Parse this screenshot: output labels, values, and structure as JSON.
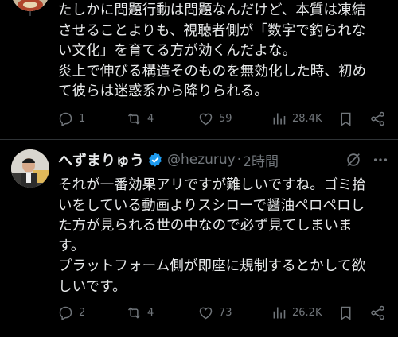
{
  "colors": {
    "background": "#000000",
    "text": "#e7e9ea",
    "muted": "#71767b",
    "verified": "#1d9bf0",
    "divider": "#2f3336"
  },
  "tweet1": {
    "text": "たしかに問題行動は問題なんだけど、本質は凍結\nさせることよりも、視聴者側が「数字で釣られな\nい文化」を育てる方が効くんだよな。\n炎上で伸びる構造そのものを無効化した時、初め\nて彼らは迷惑系から降りられる。",
    "replies": "1",
    "reposts": "4",
    "likes": "59",
    "views": "28.4K"
  },
  "tweet2": {
    "name": "へずまりゅう",
    "handle": "@hezuruy",
    "separator": "·",
    "time": "2時間",
    "text": "それが一番効果アリですが難しいですね。ゴミ拾\nいをしている動画よりスシローで醤油ペロペロし\nた方が見られる世の中なので必ず見てしまいま\nす。\nプラットフォーム側が即座に規制するとかして欲\nしいです。",
    "replies": "2",
    "reposts": "4",
    "likes": "73",
    "views": "26.2K"
  },
  "icons": [
    "reply-icon",
    "repost-icon",
    "like-icon",
    "views-icon",
    "bookmark-icon",
    "share-icon",
    "verified-badge-icon",
    "grok-icon",
    "more-icon"
  ]
}
